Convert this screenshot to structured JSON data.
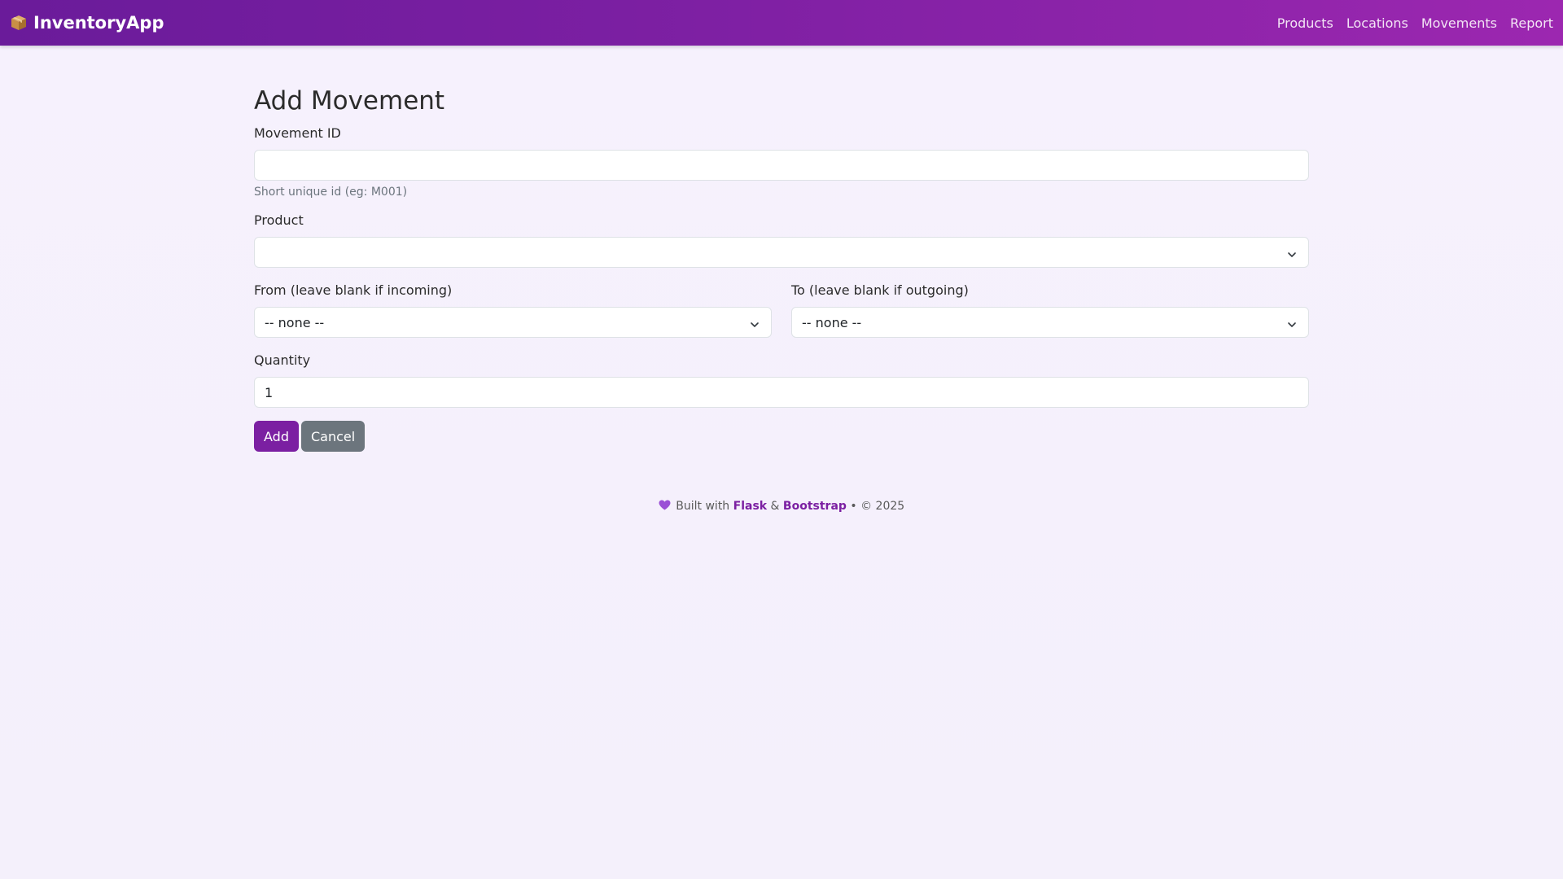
{
  "navbar": {
    "brand": "InventoryApp",
    "brand_icon": "package-icon",
    "links": [
      "Products",
      "Locations",
      "Movements",
      "Report"
    ]
  },
  "page": {
    "title": "Add Movement"
  },
  "form": {
    "movement_id": {
      "label": "Movement ID",
      "value": "",
      "help": "Short unique id (eg: M001)"
    },
    "product": {
      "label": "Product",
      "selected": ""
    },
    "from": {
      "label": "From (leave blank if incoming)",
      "selected": "-- none --"
    },
    "to": {
      "label": "To (leave blank if outgoing)",
      "selected": "-- none --"
    },
    "quantity": {
      "label": "Quantity",
      "value": "1"
    },
    "add_label": "Add",
    "cancel_label": "Cancel"
  },
  "footer": {
    "icon": "purple-heart-icon",
    "built_with": "Built with",
    "flask": "Flask",
    "amp": "&",
    "bootstrap": "Bootstrap",
    "copyright": "• © 2025"
  },
  "colors": {
    "accent": "#7b1fa2",
    "navbar_start": "#6a1b9a",
    "navbar_end": "#9c27b0",
    "secondary": "#6c757d",
    "background": "#f6f1fd"
  }
}
